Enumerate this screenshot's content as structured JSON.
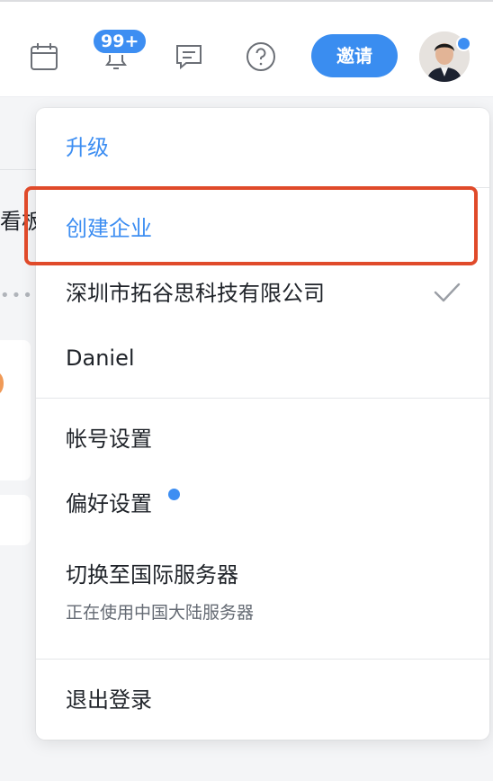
{
  "header": {
    "notification_badge": "99+",
    "invite_label": "邀请",
    "icons": [
      "calendar-icon",
      "bell-icon",
      "message-icon",
      "help-icon"
    ]
  },
  "background": {
    "partial_title": "看板"
  },
  "menu": {
    "upgrade": "升级",
    "create_enterprise": "创建企业",
    "organizations": [
      {
        "name": "深圳市拓谷思科技有限公司",
        "selected": true
      },
      {
        "name": "Daniel",
        "selected": false
      }
    ],
    "account_settings": "帐号设置",
    "preferences": "偏好设置",
    "switch_server": "切换至国际服务器",
    "switch_server_subtitle": "正在使用中国大陆服务器",
    "logout": "退出登录"
  },
  "colors": {
    "accent": "#3d8ef2",
    "highlight_border": "#e04a2a"
  }
}
